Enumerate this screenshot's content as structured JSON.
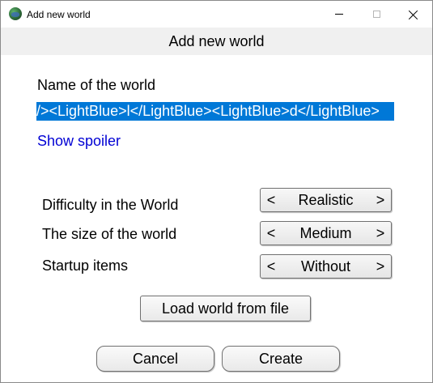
{
  "window": {
    "title": "Add new world",
    "icon": "app-globe-icon"
  },
  "header": {
    "title": "Add new world"
  },
  "name_field": {
    "label": "Name of the world",
    "value": "<LightBlue>l</LightBlue><LightBlue>l</LightBlue><LightBlue>d</LightBlue>",
    "visible_value": "/><LightBlue>l</LightBlue><LightBlue>d</LightBlue>",
    "selected": true,
    "selection_color": "#0078d7"
  },
  "spoiler": {
    "label": "Show spoiler",
    "color": "#0000d4"
  },
  "options": {
    "difficulty": {
      "label": "Difficulty in the World",
      "value": "Realistic",
      "prev": "<",
      "next": ">"
    },
    "size": {
      "label": "The size of the world",
      "value": "Medium",
      "prev": "<",
      "next": ">"
    },
    "startup_items": {
      "label": "Startup items",
      "value": "Without",
      "prev": "<",
      "next": ">"
    }
  },
  "buttons": {
    "load": "Load world from file",
    "cancel": "Cancel",
    "create": "Create"
  }
}
